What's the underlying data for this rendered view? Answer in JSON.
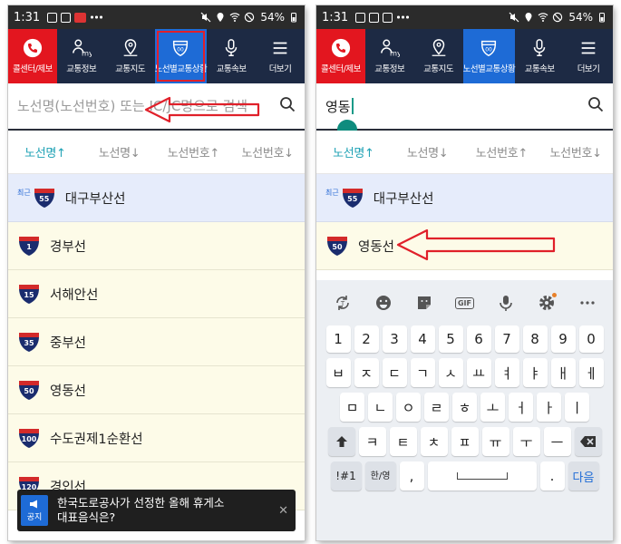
{
  "status": {
    "time": "1:31",
    "battery": "54%"
  },
  "nav": [
    {
      "label": "콜센터/제보",
      "icon": "phone-icon"
    },
    {
      "label": "교통정보",
      "icon": "my-icon",
      "badge": "my"
    },
    {
      "label": "교통지도",
      "icon": "map-pin-icon"
    },
    {
      "label": "노선별교통상황",
      "icon": "route-shield-icon"
    },
    {
      "label": "교통속보",
      "icon": "microphone-icon"
    },
    {
      "label": "더보기",
      "icon": "menu-icon"
    }
  ],
  "left": {
    "search_placeholder": "노선명(노선번호) 또는 IC/JC명으로 검색",
    "sort_tabs": [
      "노선명↑",
      "노선명↓",
      "노선번호↑",
      "노선번호↓"
    ],
    "recent_tag": "최근",
    "rows": [
      {
        "num": "55",
        "name": "대구부산선",
        "recent": true
      },
      {
        "num": "1",
        "name": "경부선"
      },
      {
        "num": "15",
        "name": "서해안선"
      },
      {
        "num": "35",
        "name": "중부선"
      },
      {
        "num": "50",
        "name": "영동선"
      },
      {
        "num": "100",
        "name": "수도권제1순환선"
      },
      {
        "num": "120",
        "name": "경인선"
      }
    ],
    "toast": {
      "badge": "공지",
      "message_line1": "한국도로공사가 선정한 올해 휴게소",
      "message_line2": "대표음식은?",
      "close": "✕"
    }
  },
  "right": {
    "search_value": "영동",
    "sort_tabs": [
      "노선명↑",
      "노선명↓",
      "노선번호↑",
      "노선번호↓"
    ],
    "recent_tag": "최근",
    "rows": [
      {
        "num": "55",
        "name": "대구부산선",
        "recent": true
      },
      {
        "num": "50",
        "name": "영동선"
      }
    ],
    "keyboard": {
      "toolbar": [
        "translate-icon",
        "emoji-icon",
        "sticker-icon",
        "GIF",
        "microphone-icon",
        "settings-icon",
        "more-icon"
      ],
      "row_numbers": [
        "1",
        "2",
        "3",
        "4",
        "5",
        "6",
        "7",
        "8",
        "9",
        "0"
      ],
      "row1": [
        "ㅂ",
        "ㅈ",
        "ㄷ",
        "ㄱ",
        "ㅅ",
        "ㅛ",
        "ㅕ",
        "ㅑ",
        "ㅐ",
        "ㅔ"
      ],
      "row2": [
        "ㅁ",
        "ㄴ",
        "ㅇ",
        "ㄹ",
        "ㅎ",
        "ㅗ",
        "ㅓ",
        "ㅏ",
        "ㅣ"
      ],
      "row3": [
        "ㅋ",
        "ㅌ",
        "ㅊ",
        "ㅍ",
        "ㅠ",
        "ㅜ",
        "ㅡ"
      ],
      "symbols": "!#1",
      "lang_top": "한",
      "lang_bottom": "영",
      "comma": ",",
      "period": ".",
      "done": "다음"
    }
  },
  "colors": {
    "navy": "#1d2a44",
    "red": "#e3161f",
    "blue": "#1e6bd6",
    "teal": "#1fa2b5",
    "annot": "#e0202a"
  }
}
